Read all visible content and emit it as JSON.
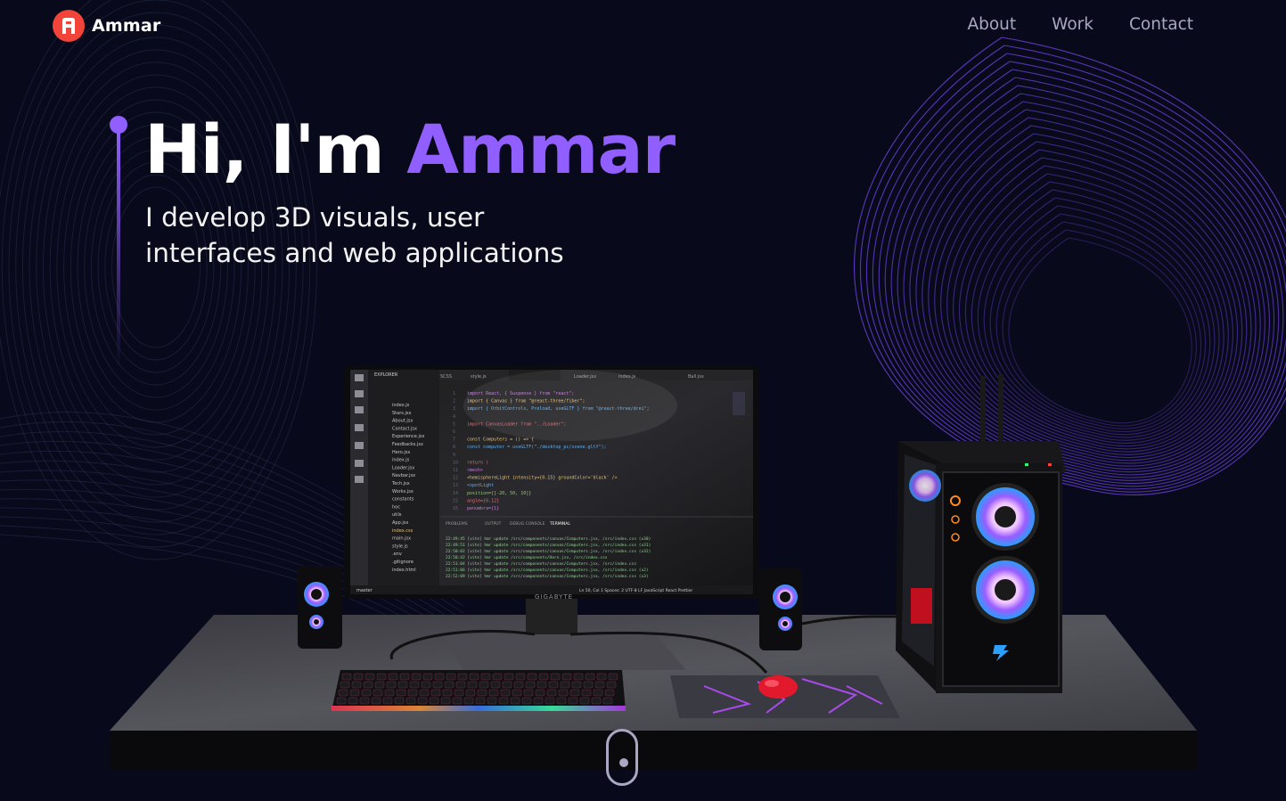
{
  "brand": {
    "name": "Ammar",
    "logo_letter": "A",
    "logo_color": "#f24438"
  },
  "nav": {
    "links": [
      "About",
      "Work",
      "Contact"
    ]
  },
  "hero": {
    "greeting": "Hi, I'm ",
    "name": "Ammar",
    "subtitle_line1": "I develop 3D visuals, user",
    "subtitle_line2": "interfaces and web applications"
  },
  "monitor": {
    "brand": "GIGABYTE",
    "editor_tabs": [
      "SCSS",
      "style.js",
      "Computers.jsx",
      "Loader.jsx",
      "index.js",
      "Ball.jsx"
    ],
    "files": [
      "index.js",
      "Stars.jsx",
      "About.jsx",
      "Contact.jsx",
      "Experience.jsx",
      "Feedbacks.jsx",
      "Hero.jsx",
      "index.js",
      "Loader.jsx",
      "Navbar.jsx",
      "Tech.jsx",
      "Works.jsx",
      "constants",
      "hoc",
      "utils",
      "App.jsx",
      "index.css",
      "main.jsx",
      "style.js",
      ".env",
      ".gitignore",
      "index.html"
    ],
    "code_lines": [
      "import React, { Suspense } from \"react\";",
      "import { Canvas } from \"@react-three/fiber\";",
      "import { OrbitControls, Preload, useGLTF } from \"@react-three/drei\";",
      "",
      "import CanvasLoader from \"../Loader\";",
      "",
      "const Computers = () => {",
      "  const computer = useGLTF(\"./desktop_pc/scene.gltf\");",
      "",
      "  return (",
      "    <mesh>",
      "      <hemisphereLight intensity={0.15} groundColor='black' />",
      "      <spotLight",
      "        position={[-20, 50, 10]}",
      "        angle={0.12}",
      "        penumbra={1}"
    ],
    "panel_tabs": [
      "PROBLEMS",
      "OUTPUT",
      "DEBUG CONSOLE",
      "TERMINAL"
    ],
    "terminal_lines": [
      "22:49:45 [vite] hmr update /src/components/canvas/Computers.jsx, /src/index.css (x30)",
      "22:49:51 [vite] hmr update /src/components/canvas/Computers.jsx, /src/index.css (x31)",
      "22:50:02 [vite] hmr update /src/components/canvas/Computers.jsx, /src/index.css (x32)",
      "22:50:42 [vite] hmr update /src/components/Hero.jsx, /src/index.css",
      "22:51:04 [vite] hmr update /src/components/canvas/Computers.jsx, /src/index.css",
      "22:51:06 [vite] hmr update /src/components/canvas/Computers.jsx, /src/index.css (x2)",
      "22:52:09 [vite] hmr update /src/components/canvas/Computers.jsx, /src/index.css (x3)"
    ],
    "status_left": "master",
    "status_right": "Ln 50, Col 1  Spaces: 2  UTF-8  LF  JavaScript React  Prettier"
  },
  "colors": {
    "accent": "#915eff",
    "background": "#080a1b",
    "nav_text": "#aaa6c3",
    "waves": "#6a3fd6"
  }
}
